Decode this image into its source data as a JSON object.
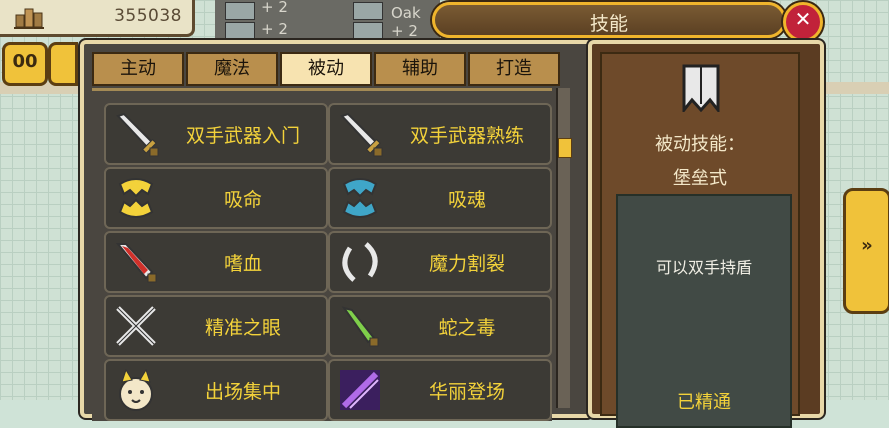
{
  "resources": {
    "value": "355038",
    "icon": "building-icon"
  },
  "top_strip": {
    "texts": [
      "+ 2",
      "Oak",
      "+ 2",
      "+ 2"
    ]
  },
  "window": {
    "title": "技能",
    "close_icon": "close-icon"
  },
  "menu_button": {
    "label": "00"
  },
  "tabs": [
    {
      "label": "主动",
      "active": false
    },
    {
      "label": "魔法",
      "active": false
    },
    {
      "label": "被动",
      "active": true
    },
    {
      "label": "辅助",
      "active": false
    },
    {
      "label": "打造",
      "active": false
    }
  ],
  "skills": [
    {
      "name": "双手武器入门",
      "icon": "sword-icon"
    },
    {
      "name": "双手武器熟练",
      "icon": "sword-icon"
    },
    {
      "name": "吸命",
      "icon": "yellow-fang-icon"
    },
    {
      "name": "吸魂",
      "icon": "blue-fang-icon"
    },
    {
      "name": "嗜血",
      "icon": "blood-dagger-icon"
    },
    {
      "name": "魔力割裂",
      "icon": "crescent-slash-icon"
    },
    {
      "name": "精准之眼",
      "icon": "crossed-blades-icon"
    },
    {
      "name": "蛇之毒",
      "icon": "poison-dagger-icon"
    },
    {
      "name": "出场集中",
      "icon": "cat-face-icon"
    },
    {
      "name": "华丽登场",
      "icon": "purple-sparkle-icon"
    }
  ],
  "detail": {
    "icon": "shield-banner-icon",
    "label": "被动技能：",
    "name": "堡垒式",
    "description": "可以双手持盾",
    "status": "已精通"
  },
  "next_button": {
    "label": "»"
  },
  "colors": {
    "gold": "#f0c23a",
    "skill_text": "#f3d23a",
    "panel": "#4a4640"
  }
}
